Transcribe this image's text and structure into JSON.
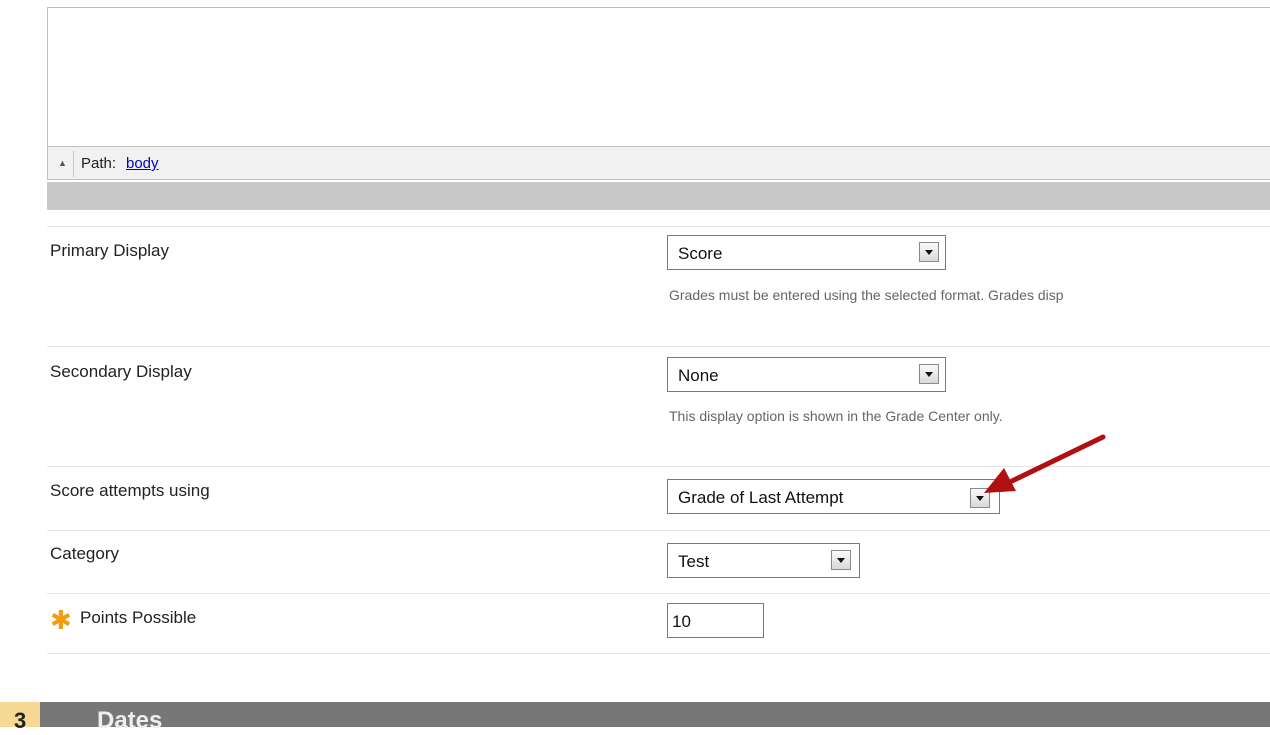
{
  "editor": {
    "path_label": "Path:",
    "path_link": "body"
  },
  "fields": {
    "primary_display": {
      "label": "Primary Display",
      "value": "Score",
      "help": "Grades must be entered using the selected format. Grades disp"
    },
    "secondary_display": {
      "label": "Secondary Display",
      "value": "None",
      "help": "This display option is shown in the Grade Center only."
    },
    "score_attempts": {
      "label": "Score attempts using",
      "value": "Grade of Last Attempt"
    },
    "category": {
      "label": "Category",
      "value": "Test"
    },
    "points_possible": {
      "label": "Points Possible",
      "value": "10",
      "required": true
    }
  },
  "next_section": {
    "number": "3",
    "title": "Dates"
  },
  "colors": {
    "required_star": "#f39c12",
    "annotation_arrow": "#b01010",
    "section_bar": "#777777",
    "section_number_bg": "#f6d992"
  }
}
